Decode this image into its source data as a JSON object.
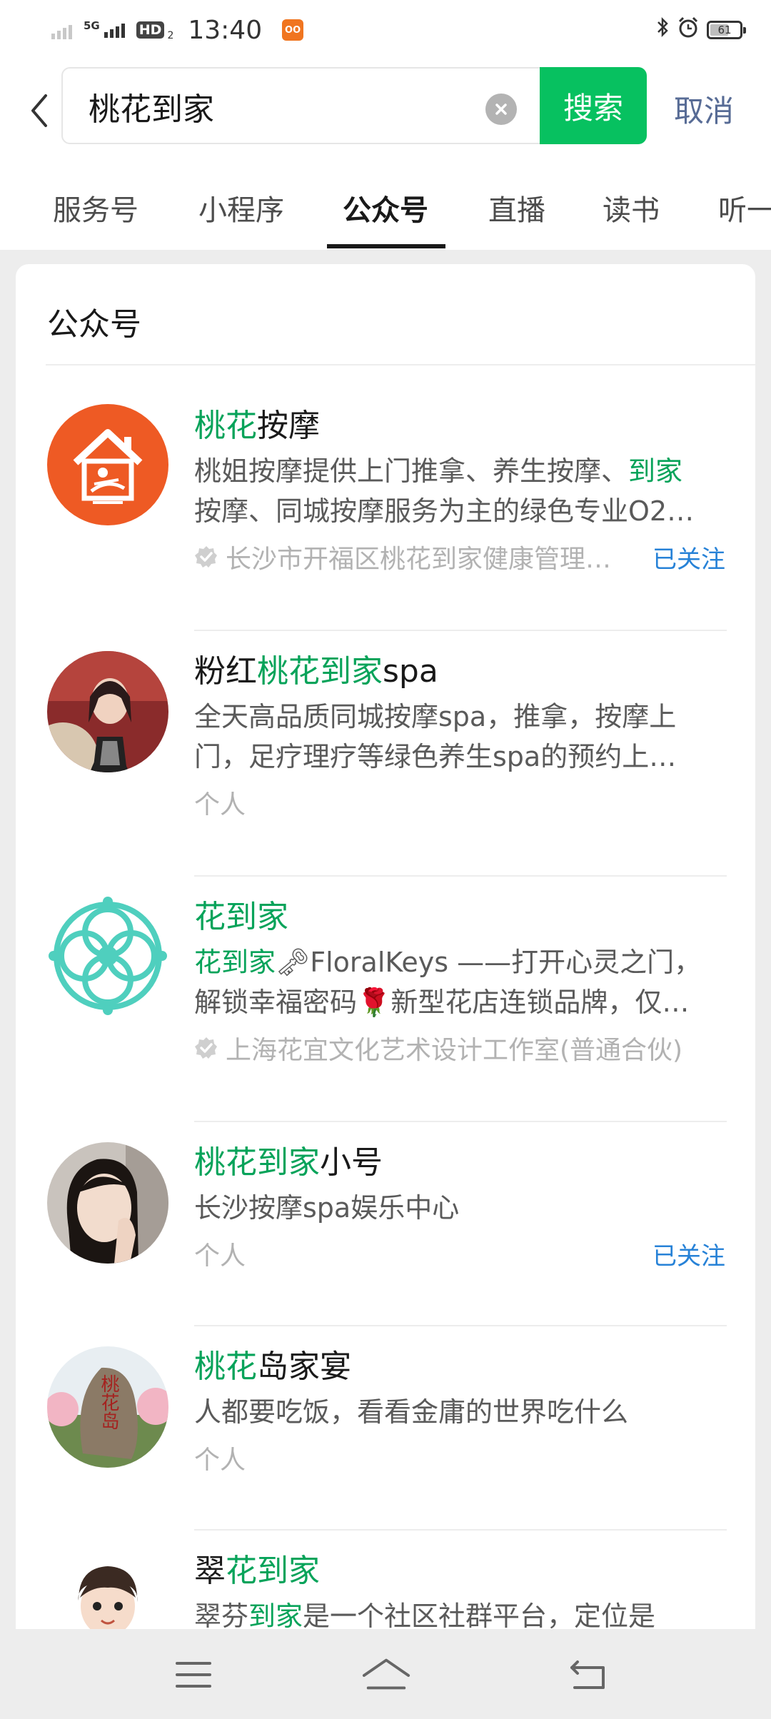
{
  "status_bar": {
    "network": "5G",
    "hd": "HD",
    "hd_sub": "2",
    "time": "13:40",
    "app_badge": "OO",
    "battery": "61",
    "battery_level_percent": 61
  },
  "search": {
    "query": "桃花到家",
    "search_label": "搜索",
    "cancel_label": "取消"
  },
  "tabs": [
    {
      "label": "服务号"
    },
    {
      "label": "小程序"
    },
    {
      "label": "公众号"
    },
    {
      "label": "直播"
    },
    {
      "label": "读书"
    },
    {
      "label": "听一"
    }
  ],
  "section_title": "公众号",
  "results": [
    {
      "name_hl": "桃花",
      "name_rest": "按摩",
      "name_mid": "",
      "desc_line1_a": "桃姐按摩提供上门推拿、养生按摩、",
      "desc_line1_hl": "到家",
      "desc_line2": "按摩、同城按摩服务为主的绿色专业O2…",
      "meta": "长沙市开福区桃花到家健康管理…",
      "followed": "已关注"
    },
    {
      "name_pre": "粉红",
      "name_hl": "桃花到家",
      "name_rest": "spa",
      "desc_line1": "全天高品质同城按摩spa，推拿，按摩上",
      "desc_line2": "门，足疗理疗等绿色养生spa的预约上…",
      "meta": "个人"
    },
    {
      "name_hl": "花到家",
      "desc_line1_hl": "花到家",
      "desc_line1_key": "🗝",
      "desc_line1_b": "FloralKeys ——打开心灵之门，",
      "desc_line2_a": "解锁幸福密码",
      "desc_line2_rose": "🌹",
      "desc_line2_b": "新型花店连锁品牌，仅…",
      "meta": "上海花宜文化艺术设计工作室(普通合伙)"
    },
    {
      "name_hl": "桃花到家",
      "name_rest": "小号",
      "desc_line1": "长沙按摩spa娱乐中心",
      "meta": "个人",
      "followed": "已关注"
    },
    {
      "name_hl": "桃花",
      "name_rest": "岛家宴",
      "desc_line1": "人都要吃饭，看看金庸的世界吃什么",
      "meta": "个人",
      "avatar_text": "桃花岛"
    },
    {
      "name_pre": "翠",
      "name_hl": "花到家",
      "desc_line1_a": "翠芬",
      "desc_line1_hl": "到家",
      "desc_line1_b": "是一个社区社群平台，定位是"
    }
  ],
  "colors": {
    "wechat_green": "#07c160",
    "highlight_green": "#07a35a",
    "link_blue": "#576b95",
    "followed_blue": "#2782d7"
  },
  "icons": {
    "back": "chevron-left-icon",
    "clear": "clear-icon",
    "verified": "verified-icon",
    "menu": "menu-icon",
    "home": "home-icon",
    "back_nav": "back-icon"
  }
}
